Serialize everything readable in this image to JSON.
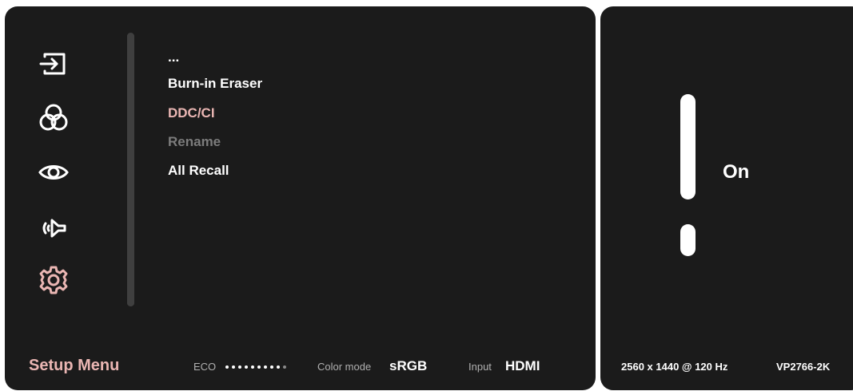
{
  "sidebar": {
    "icons": [
      "input-icon",
      "color-icon",
      "eye-icon",
      "audio-icon",
      "gear-icon"
    ],
    "selected_icon": "gear-icon"
  },
  "menu": {
    "items": [
      {
        "label": "...",
        "state": "normal"
      },
      {
        "label": "Burn-in Eraser",
        "state": "normal"
      },
      {
        "label": "DDC/CI",
        "state": "selected"
      },
      {
        "label": "Rename",
        "state": "disabled"
      },
      {
        "label": "All Recall",
        "state": "normal"
      }
    ]
  },
  "footer": {
    "title": "Setup Menu",
    "eco_label": "ECO",
    "eco_level": {
      "on": 9,
      "total": 10
    },
    "color_mode_label": "Color mode",
    "color_mode_value": "sRGB",
    "input_label": "Input",
    "input_value": "HDMI"
  },
  "side": {
    "value": "On",
    "resolution": "2560 x 1440 @ 120 Hz",
    "model": "VP2766-2K"
  },
  "colors": {
    "panel_bg": "#1b1b1b",
    "accent": "#eab6b3",
    "text": "#ffffff",
    "disabled": "#7c7c7c"
  }
}
